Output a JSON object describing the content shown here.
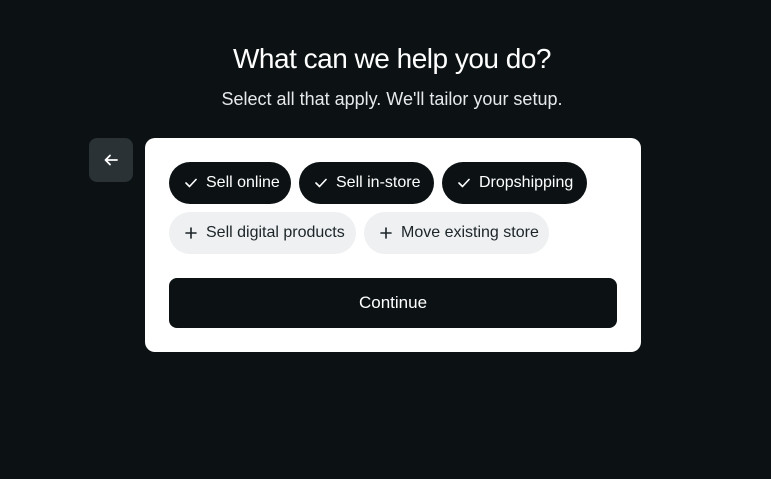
{
  "header": {
    "title": "What can we help you do?",
    "subtitle": "Select all that apply. We'll tailor your setup."
  },
  "back_button": {
    "icon": "arrow-left-icon"
  },
  "options": [
    {
      "label": "Sell online",
      "selected": true,
      "icon": "check-icon"
    },
    {
      "label": "Sell in-store",
      "selected": true,
      "icon": "check-icon"
    },
    {
      "label": "Dropshipping",
      "selected": true,
      "icon": "check-icon"
    },
    {
      "label": "Sell digital products",
      "selected": false,
      "icon": "plus-icon"
    },
    {
      "label": "Move existing store",
      "selected": false,
      "icon": "plus-icon"
    }
  ],
  "continue_button": {
    "label": "Continue"
  },
  "colors": {
    "background": "#0c1214",
    "card": "#ffffff",
    "chip_selected": "#0c1214",
    "chip_unselected": "#eef0f1",
    "back_button": "#2b3236"
  }
}
